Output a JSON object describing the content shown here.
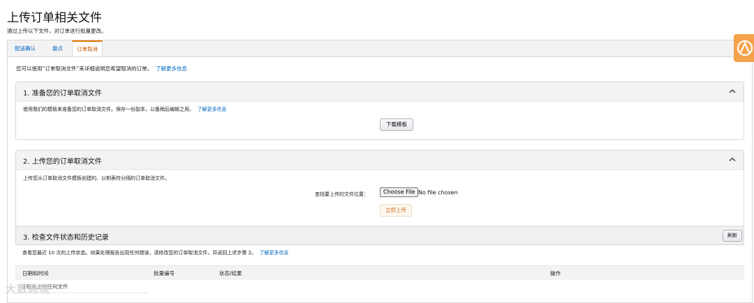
{
  "page": {
    "title": "上传订单相关文件",
    "subtitle": "通过上传以下文件，对订单进行批量更改。"
  },
  "tabs": [
    {
      "label": "配送确认",
      "active": false
    },
    {
      "label": "盘点",
      "active": false
    },
    {
      "label": "订单取消",
      "active": true
    }
  ],
  "intro": {
    "text": "您可以使用“订单取消文件”来详细说明您希望取消的订单。",
    "link": "了解更多信息"
  },
  "panel1": {
    "title": "1. 准备您的订单取消文件",
    "text": "使用我们的模板来准备您的订单取消文件。保存一份副本，以备稍后编辑之用。",
    "link": "了解更多信息",
    "button": "下载模板"
  },
  "panel2": {
    "title": "2. 上传您的订单取消文件",
    "text": "上传您从订单取消文件模板创建的、以制表符分隔的订单取消文件。",
    "file_label": "查找要上传的文件位置：",
    "choose_button": "Choose File",
    "no_file": "No file chosen",
    "upload_button": "立即上传"
  },
  "panel3": {
    "title": "3. 检查文件状态和历史记录",
    "refresh_button": "刷新",
    "text": "查看您最近 10 次的上传状态。如果处理报告出现任何错误，请修改您的订单取消文件，并返回上述步骤 2。",
    "link": "了解更多信息",
    "columns": [
      "日期和时间",
      "批量编号",
      "状态/结果",
      "操作"
    ],
    "empty_text": "没有未上传任何文件"
  },
  "watermark": "大数跨境",
  "colors": {
    "accent": "#e77600",
    "link": "#0066c0",
    "floater": "#f4a24b"
  }
}
